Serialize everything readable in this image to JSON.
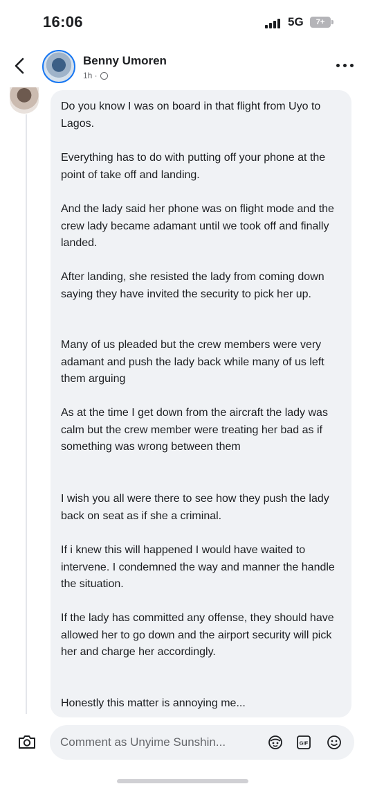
{
  "status_bar": {
    "time": "16:06",
    "network": "5G",
    "battery": "7+"
  },
  "header": {
    "back_icon": "chevron-left-icon",
    "author_name": "Benny Umoren",
    "post_age": "1h ·",
    "more_icon": "more-dots-icon"
  },
  "comment": {
    "paragraphs": [
      "Do you know I was on board in that flight from Uyo to Lagos.",
      "Everything has to do with putting off your phone at the point of take off and landing.",
      "And the lady said her phone was on flight mode and the crew lady became adamant until we took off and finally landed.",
      "After landing, she resisted the lady from coming down saying they have invited the security to pick her up.",
      "Many of us pleaded but the crew members were very adamant and push the lady back while many of us left them arguing",
      "As at the time I get down from the aircraft the lady was calm but the crew member were treating her bad as if something was wrong between them",
      "I wish you all were there to see how they push the lady back on seat as if she a criminal.",
      "If i knew this will happened I would have waited to intervene. I condemned the way and manner the handle the situation.",
      "If the lady has committed any offense, they should have allowed her to go down and the airport security will pick her and charge her accordingly.",
      "Honestly this matter is annoying me..."
    ]
  },
  "comment_bar": {
    "placeholder": "Comment as Unyime Sunshin...",
    "gif_label": "GIF",
    "icons": [
      "camera-icon",
      "avatar-sticker-icon",
      "gif-icon",
      "emoji-icon"
    ]
  },
  "colors": {
    "accent": "#1877f2",
    "bubble": "#f0f2f5",
    "text": "#1c1e21",
    "muted": "#65676b"
  }
}
